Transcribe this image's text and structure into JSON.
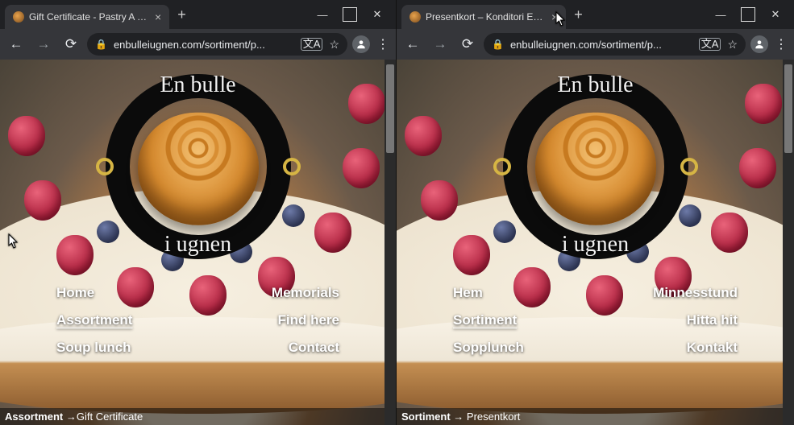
{
  "windows": [
    {
      "tab_title": "Gift Certificate - Pastry A bun in t",
      "url": "enbulleiugnen.com/sortiment/p...",
      "logo_top": "En bulle",
      "logo_bot": "i ugnen",
      "nav": {
        "home": "Home",
        "memorials": "Memorials",
        "assortment": "Assortment",
        "find": "Find here",
        "soup": "Soup lunch",
        "contact": "Contact"
      },
      "breadcrumb_a": "Assortment",
      "breadcrumb_arrow": " →",
      "breadcrumb_b": "Gift Certificate"
    },
    {
      "tab_title": "Presentkort – Konditori En bulle t",
      "url": "enbulleiugnen.com/sortiment/p...",
      "logo_top": "En bulle",
      "logo_bot": "i ugnen",
      "nav": {
        "home": "Hem",
        "memorials": "Minnesstund",
        "assortment": "Sortiment",
        "find": "Hitta hit",
        "soup": "Sopplunch",
        "contact": "Kontakt"
      },
      "breadcrumb_a": "Sortiment",
      "breadcrumb_arrow": " → ",
      "breadcrumb_b": "Presentkort"
    }
  ]
}
